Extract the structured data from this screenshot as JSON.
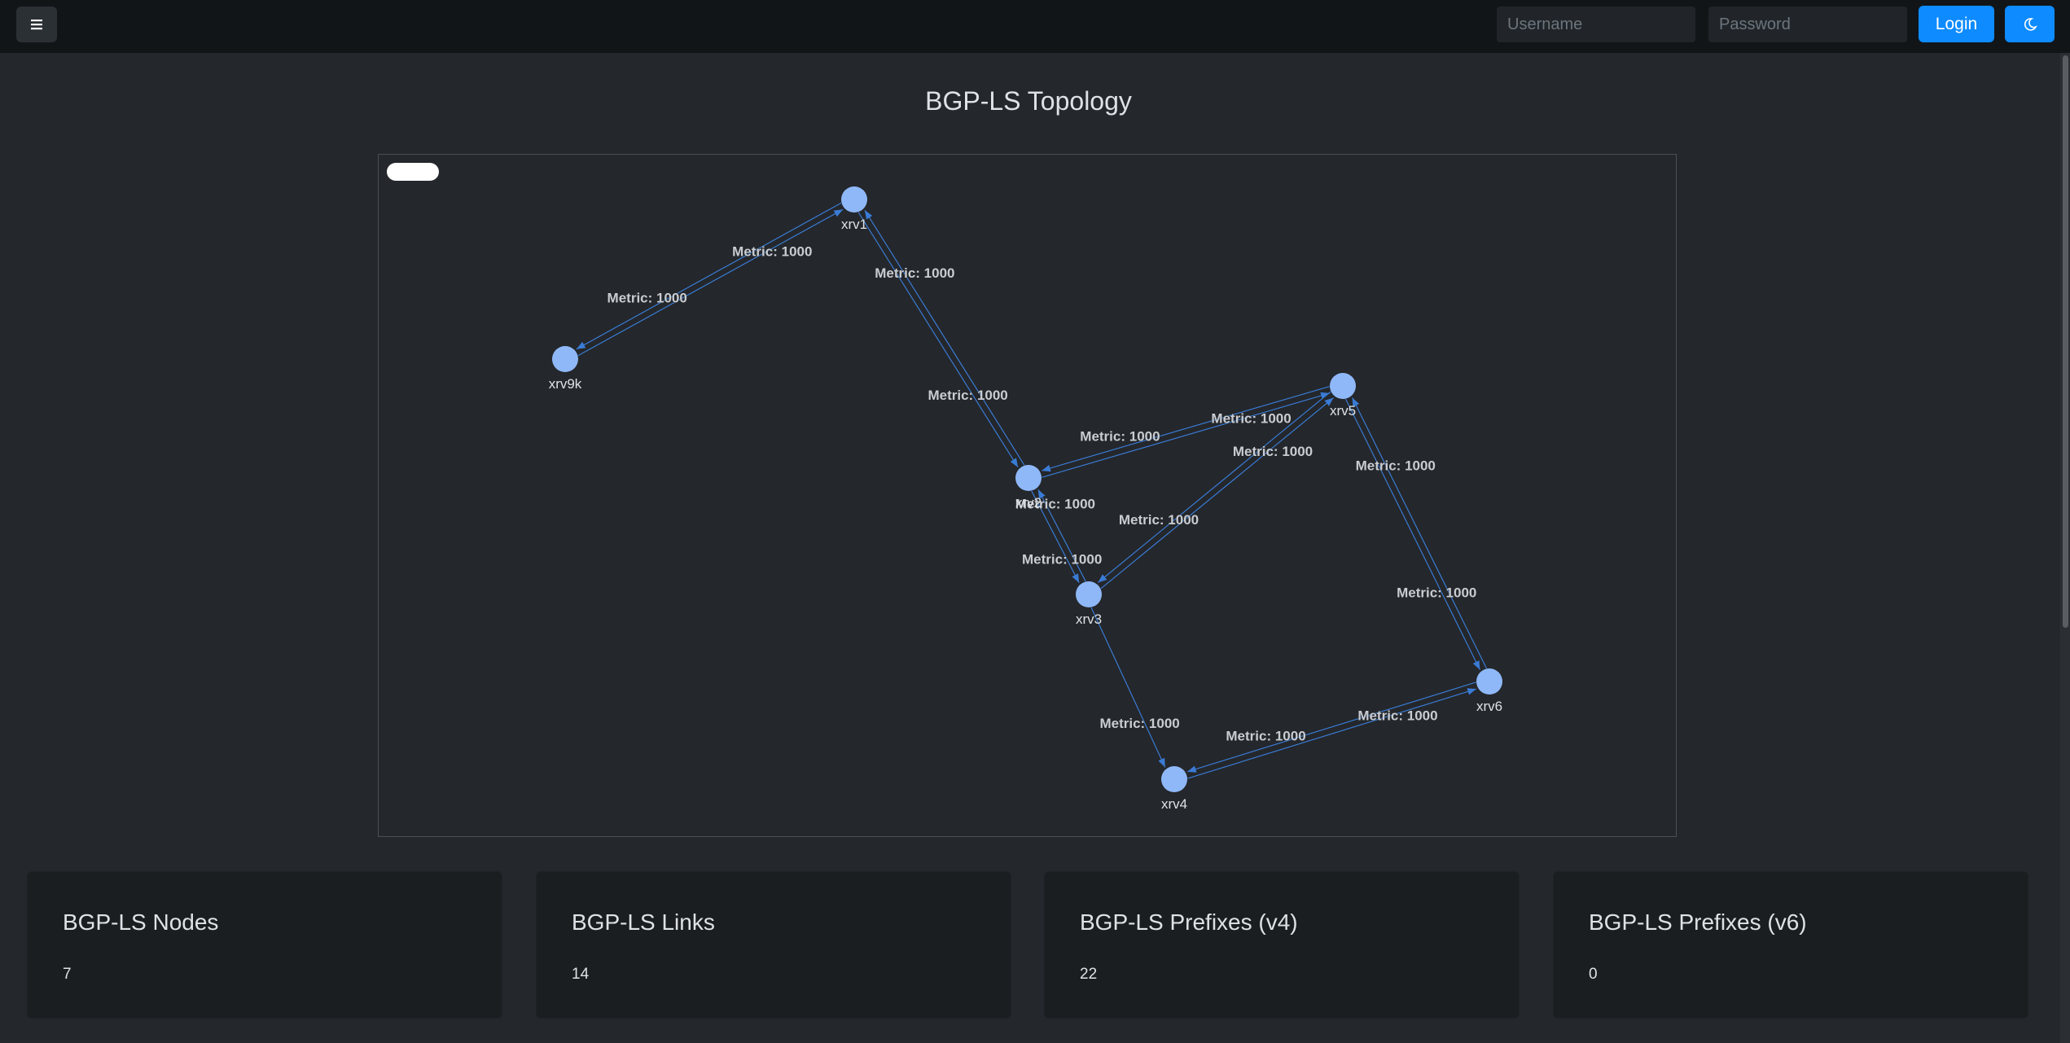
{
  "navbar": {
    "username_placeholder": "Username",
    "password_placeholder": "Password",
    "login_label": "Login",
    "menu_icon": "hamburger-icon",
    "theme_icon": "moon-icon",
    "accent_color": "#0d8bff"
  },
  "page": {
    "title": "BGP-LS Topology"
  },
  "topology": {
    "node_color": "#8fb8f8",
    "edge_color": "#3a7bd5",
    "nodes": [
      {
        "id": "xrv1",
        "label": "xrv1"
      },
      {
        "id": "xrv9k",
        "label": "xrv9k"
      },
      {
        "id": "xrv2",
        "label": "xrv2"
      },
      {
        "id": "xrv3",
        "label": "xrv3"
      },
      {
        "id": "xrv4",
        "label": "xrv4"
      },
      {
        "id": "xrv5",
        "label": "xrv5"
      },
      {
        "id": "xrv6",
        "label": "xrv6"
      }
    ],
    "links": [
      {
        "from": "xrv9k",
        "to": "xrv1",
        "label": "Metric: 1000"
      },
      {
        "from": "xrv1",
        "to": "xrv9k",
        "label": "Metric: 1000"
      },
      {
        "from": "xrv1",
        "to": "xrv2",
        "label": "Metric: 1000"
      },
      {
        "from": "xrv2",
        "to": "xrv1",
        "label": "Metric: 1000"
      },
      {
        "from": "xrv2",
        "to": "xrv5",
        "label": "Metric: 1000"
      },
      {
        "from": "xrv5",
        "to": "xrv2",
        "label": "Metric: 1000"
      },
      {
        "from": "xrv3",
        "to": "xrv5",
        "label": "Metric: 1000"
      },
      {
        "from": "xrv5",
        "to": "xrv3",
        "label": "Metric: 1000"
      },
      {
        "from": "xrv2",
        "to": "xrv3",
        "label": "Metric: 1000"
      },
      {
        "from": "xrv3",
        "to": "xrv2",
        "label": "Metric: 1000"
      },
      {
        "from": "xrv3",
        "to": "xrv4",
        "label": "Metric: 1000"
      },
      {
        "from": "xrv5",
        "to": "xrv6",
        "label": "Metric: 1000"
      },
      {
        "from": "xrv6",
        "to": "xrv5",
        "label": "Metric: 1000"
      },
      {
        "from": "xrv4",
        "to": "xrv6",
        "label": "Metric: 1000"
      },
      {
        "from": "xrv6",
        "to": "xrv4",
        "label": "Metric: 1000"
      }
    ]
  },
  "cards": [
    {
      "title": "BGP-LS Nodes",
      "value": "7"
    },
    {
      "title": "BGP-LS Links",
      "value": "14"
    },
    {
      "title": "BGP-LS Prefixes (v4)",
      "value": "22"
    },
    {
      "title": "BGP-LS Prefixes (v6)",
      "value": "0"
    }
  ]
}
